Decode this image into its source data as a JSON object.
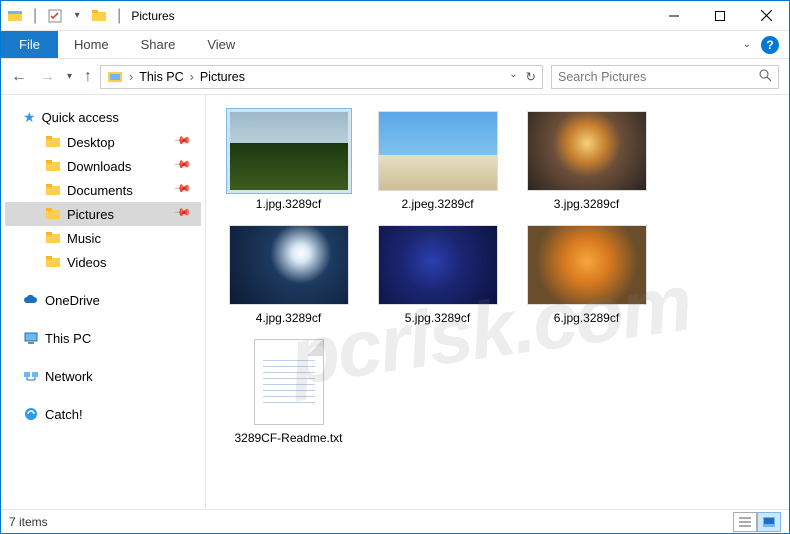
{
  "window": {
    "title": "Pictures"
  },
  "ribbon": {
    "file": "File",
    "tabs": [
      "Home",
      "Share",
      "View"
    ]
  },
  "breadcrumbs": [
    "This PC",
    "Pictures"
  ],
  "search": {
    "placeholder": "Search Pictures"
  },
  "sidebar": {
    "quick_access": "Quick access",
    "items": [
      {
        "label": "Desktop",
        "pinned": true
      },
      {
        "label": "Downloads",
        "pinned": true
      },
      {
        "label": "Documents",
        "pinned": true
      },
      {
        "label": "Pictures",
        "pinned": true,
        "selected": true
      },
      {
        "label": "Music",
        "pinned": false
      },
      {
        "label": "Videos",
        "pinned": false
      }
    ],
    "onedrive": "OneDrive",
    "this_pc": "This PC",
    "network": "Network",
    "catch": "Catch!"
  },
  "files": [
    {
      "name": "1.jpg.3289cf",
      "kind": "image",
      "thumb": "t1",
      "selected": true
    },
    {
      "name": "2.jpeg.3289cf",
      "kind": "image",
      "thumb": "t2"
    },
    {
      "name": "3.jpg.3289cf",
      "kind": "image",
      "thumb": "t3"
    },
    {
      "name": "4.jpg.3289cf",
      "kind": "image",
      "thumb": "t4"
    },
    {
      "name": "5.jpg.3289cf",
      "kind": "image",
      "thumb": "t5"
    },
    {
      "name": "6.jpg.3289cf",
      "kind": "image",
      "thumb": "t6"
    },
    {
      "name": "3289CF-Readme.txt",
      "kind": "text"
    }
  ],
  "status": {
    "count": "7 items"
  },
  "watermark": "pcrisk.com"
}
